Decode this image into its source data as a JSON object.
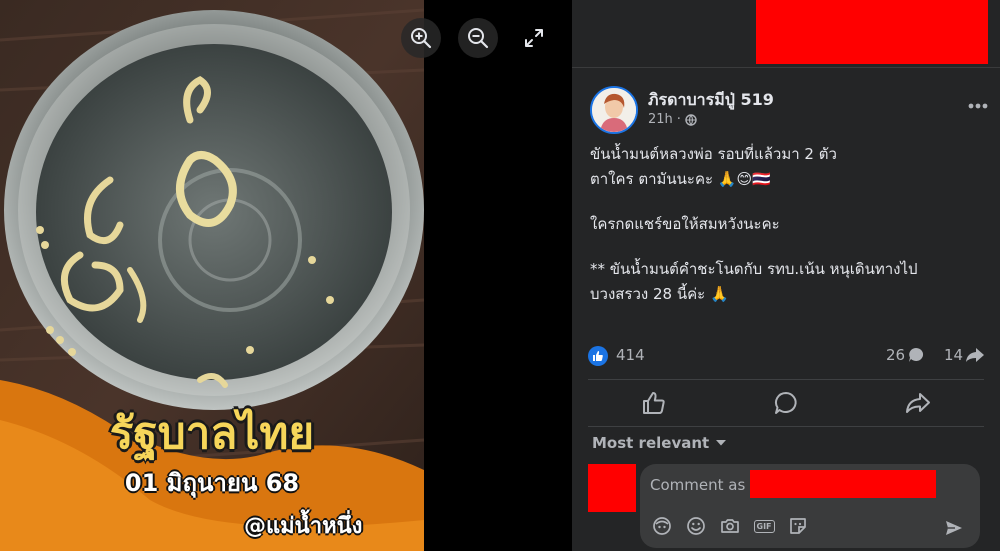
{
  "viewer": {
    "overlay_title": "รัฐบาลไทย",
    "overlay_date": "01 มิถุนายน 68",
    "overlay_handle": "@แม่น้ำหนึ่ง"
  },
  "post": {
    "author": "ภิรดาบารมีปู่ 519",
    "time": "21h",
    "separator": "·",
    "lines": [
      "ขันน้ำมนต์หลวงพ่อ รอบที่แล้วมา 2 ตัว",
      "ตาใคร ตามันนะคะ 🙏😊🇹🇭",
      "",
      "ใครกดแชร์ขอให้สมหวังนะคะ",
      "",
      "** ขันน้ำมนต์คำชะโนดกับ รทบ.เน้น หนุเดินทางไป",
      "บวงสรวง 28 นี้ค่ะ 🙏"
    ],
    "likes": "414",
    "comments": "26",
    "shares": "14"
  },
  "comments": {
    "sort_label": "Most relevant",
    "input_placeholder": "Comment as"
  },
  "colors": {
    "panel_bg": "#242526",
    "accent": "#1b74e4",
    "redaction": "#ff0000"
  }
}
